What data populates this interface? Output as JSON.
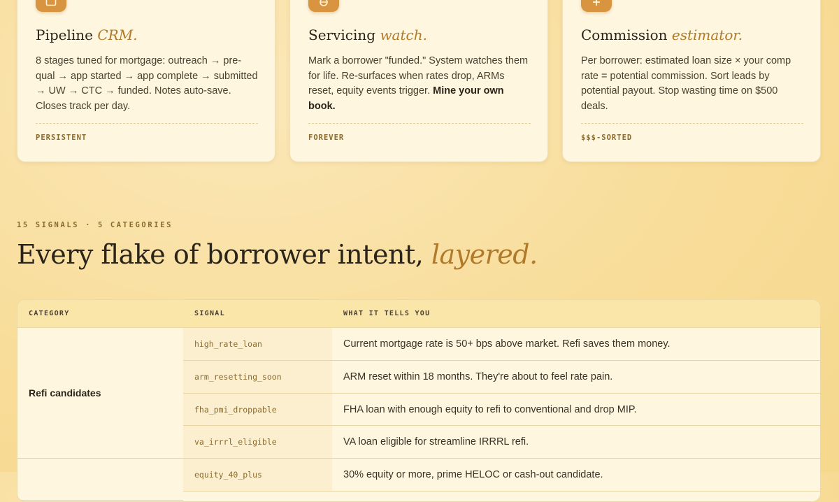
{
  "cards": [
    {
      "icon": "inbox-icon",
      "title_main": "Pipeline",
      "title_accent": "CRM.",
      "body": "8 stages tuned for mortgage: outreach → pre-qual → app started → app complete → submitted → UW → CTC → funded. Notes auto-save. Closes track per day.",
      "body_bold": "",
      "tag": "PERSISTENT"
    },
    {
      "icon": "globe-icon",
      "title_main": "Servicing",
      "title_accent": "watch.",
      "body": "Mark a borrower \"funded.\" System watches them for life. Re-surfaces when rates drop, ARMs reset, equity events trigger. ",
      "body_bold": "Mine your own book.",
      "tag": "FOREVER"
    },
    {
      "icon": "plus-icon",
      "title_main": "Commission",
      "title_accent": "estimator.",
      "body": "Per borrower: estimated loan size × your comp rate = potential commission. Sort leads by potential payout. Stop wasting time on $500 deals.",
      "body_bold": "",
      "tag": "$$$-SORTED"
    }
  ],
  "section": {
    "eyebrow": "15 SIGNALS · 5 CATEGORIES",
    "heading_main": "Every flake of borrower intent,",
    "heading_accent": "layered."
  },
  "table": {
    "headers": [
      "CATEGORY",
      "SIGNAL",
      "WHAT IT TELLS YOU"
    ],
    "groups": [
      {
        "category": "Refi candidates",
        "rows": [
          {
            "signal": "high_rate_loan",
            "desc": "Current mortgage rate is 50+ bps above market. Refi saves them money."
          },
          {
            "signal": "arm_resetting_soon",
            "desc": "ARM reset within 18 months. They're about to feel rate pain."
          },
          {
            "signal": "fha_pmi_droppable",
            "desc": "FHA loan with enough equity to refi to conventional and drop MIP."
          },
          {
            "signal": "va_irrrl_eligible",
            "desc": "VA loan eligible for streamline IRRRL refi."
          }
        ]
      },
      {
        "category": "",
        "rows": [
          {
            "signal": "equity_40_plus",
            "desc": "30% equity or more, prime HELOC or cash-out candidate."
          }
        ]
      }
    ]
  }
}
